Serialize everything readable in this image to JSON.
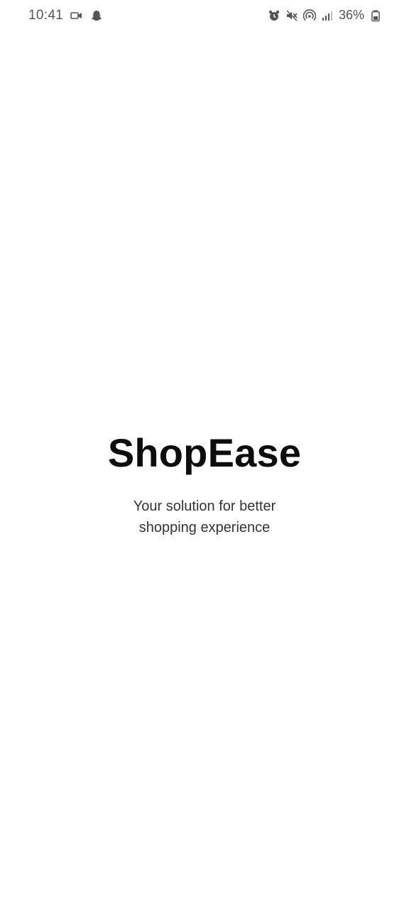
{
  "status_bar": {
    "time": "10:41",
    "battery_percent": "36%",
    "left_icons": [
      "video-camera-icon",
      "snapchat-ghost-icon"
    ],
    "right_icons": [
      "alarm-icon",
      "mute-icon",
      "hotspot-icon",
      "signal-icon",
      "battery-icon"
    ]
  },
  "splash": {
    "title": "ShopEase",
    "tagline": "Your solution for better shopping experience"
  },
  "colors": {
    "background": "#ffffff",
    "title": "#0d0d0d",
    "tagline": "#333333",
    "status": "#555555"
  }
}
